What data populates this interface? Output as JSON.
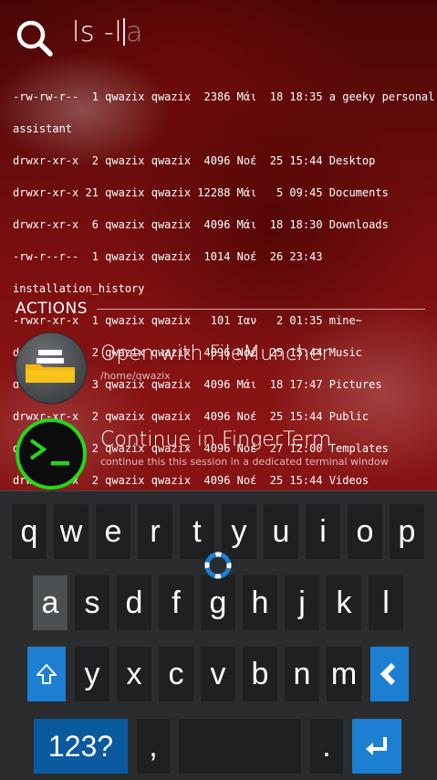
{
  "search": {
    "typed": "ls -l",
    "suggestion": "a"
  },
  "terminal": {
    "lines": [
      "-rw-rw-r--  1 qwazix qwazix  2386 Μάι  18 18:35 a geeky personal",
      "assistant",
      "drwxr-xr-x  2 qwazix qwazix  4096 Νοέ  25 15:44 Desktop",
      "drwxr-xr-x 21 qwazix qwazix 12288 Μάι   5 09:45 Documents",
      "drwxr-xr-x  6 qwazix qwazix  4096 Μάι  18 18:30 Downloads",
      "-rw-r--r--  1 qwazix qwazix  1014 Νοέ  26 23:43",
      "installation_history",
      "-rwxr-xr-x  1 qwazix qwazix   101 Ιαν   2 01:35 mine~",
      "drwxr-xr-x  2 qwazix qwazix  4096 Νοέ  25 15:44 Music",
      "drwxr-xr-x  3 qwazix qwazix  4096 Μάι  18 17:47 Pictures",
      "drwxr-xr-x  2 qwazix qwazix  4096 Νοέ  25 15:44 Public",
      "drwxr-xr-x  2 qwazix qwazix  4096 Νοέ  27 12:00 Templates",
      "drwxr-xr-x  2 qwazix qwazix  4096 Νοέ  25 15:44 Videos"
    ]
  },
  "actions": {
    "header": "ACTIONS",
    "items": [
      {
        "title": "Open with FileMuncher",
        "subtitle": "/home/qwazix",
        "icon": "folder-icon"
      },
      {
        "title": "Continue in FingerTerm",
        "subtitle": "continue this this session in a dedicated terminal window",
        "icon": "terminal-icon"
      }
    ]
  },
  "keyboard": {
    "row1": [
      "q",
      "w",
      "e",
      "r",
      "t",
      "y",
      "u",
      "i",
      "o",
      "p"
    ],
    "row2": [
      "a",
      "s",
      "d",
      "f",
      "g",
      "h",
      "j",
      "k",
      "l"
    ],
    "row3": [
      "y",
      "x",
      "c",
      "v",
      "b",
      "n",
      "m"
    ],
    "symbols_label": "123?",
    "comma": ",",
    "period": ".",
    "accent_color": "#1d7fd1",
    "icons": [
      "shift-icon",
      "backspace-icon",
      "enter-icon"
    ]
  }
}
